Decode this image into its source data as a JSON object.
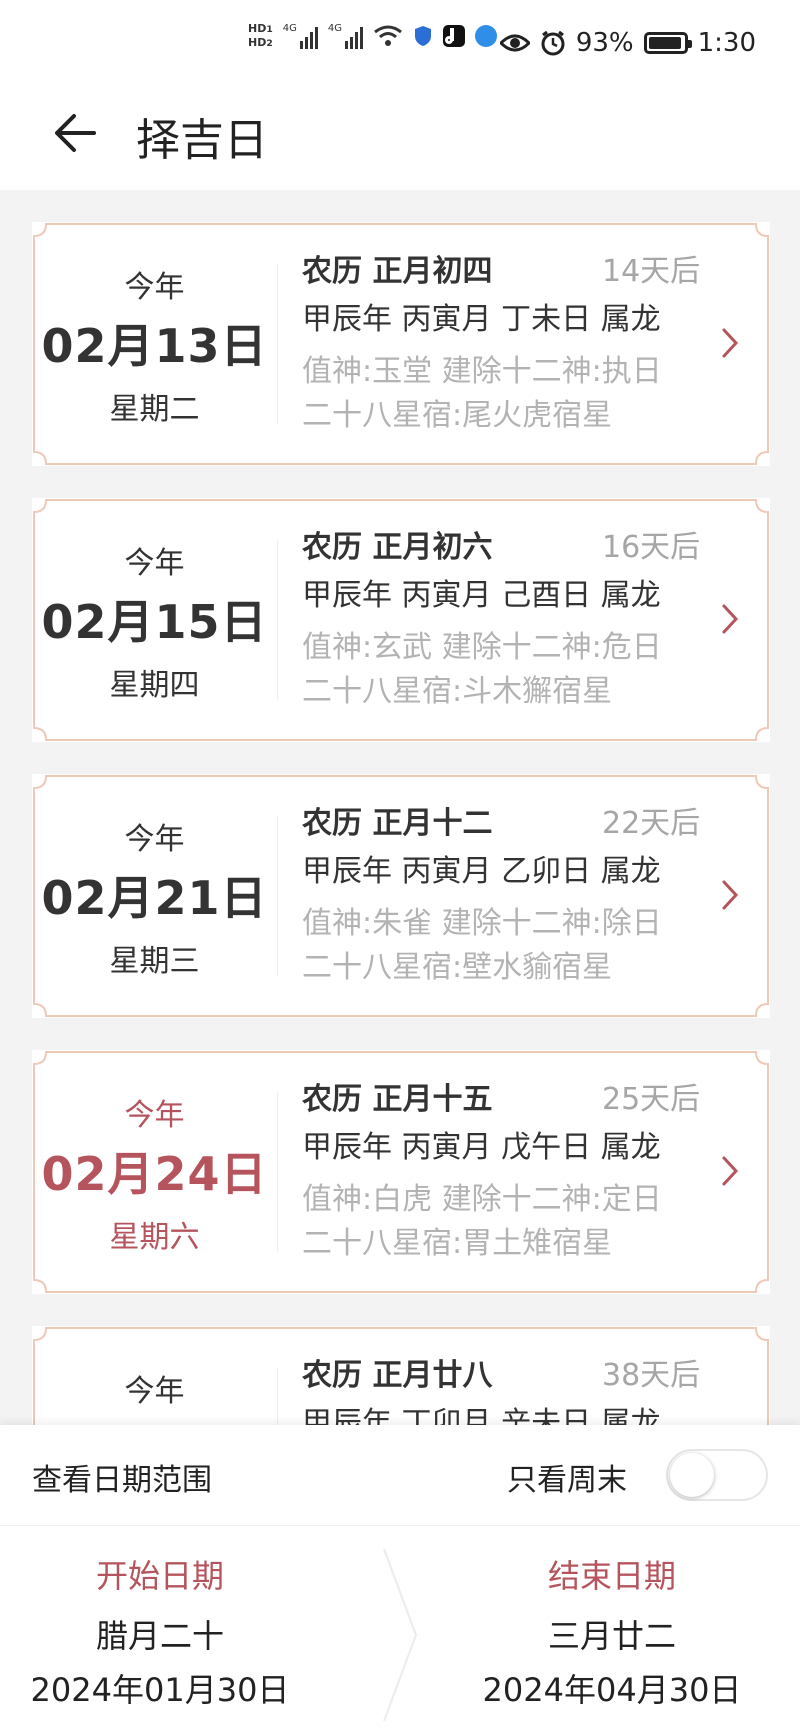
{
  "status_bar": {
    "hd1": "HD",
    "hd1_sub": "1",
    "hd2": "HD",
    "hd2_sub": "2",
    "sig1": "4G",
    "sig2": "4G",
    "battery": "93%",
    "time": "1:30",
    "icons": [
      "signal-icon",
      "wifi-icon",
      "shield-icon",
      "tiktok-icon",
      "browser-icon",
      "eye-icon",
      "alarm-icon",
      "battery-icon"
    ]
  },
  "header": {
    "title": "择吉日"
  },
  "days": [
    {
      "year": "今年",
      "date": "02月13日",
      "weekday": "星期二",
      "lunar": "农历 正月初四",
      "days_after": "14天后",
      "ganzhi": "甲辰年 丙寅月 丁未日 属龙",
      "deity": "值神:玉堂 建除十二神:执日",
      "mansion": "二十八星宿:尾火虎宿星",
      "highlight": false
    },
    {
      "year": "今年",
      "date": "02月15日",
      "weekday": "星期四",
      "lunar": "农历 正月初六",
      "days_after": "16天后",
      "ganzhi": "甲辰年 丙寅月 己酉日 属龙",
      "deity": "值神:玄武 建除十二神:危日",
      "mansion": "二十八星宿:斗木獬宿星",
      "highlight": false
    },
    {
      "year": "今年",
      "date": "02月21日",
      "weekday": "星期三",
      "lunar": "农历 正月十二",
      "days_after": "22天后",
      "ganzhi": "甲辰年 丙寅月 乙卯日 属龙",
      "deity": "值神:朱雀 建除十二神:除日",
      "mansion": "二十八星宿:壁水貐宿星",
      "highlight": false
    },
    {
      "year": "今年",
      "date": "02月24日",
      "weekday": "星期六",
      "lunar": "农历 正月十五",
      "days_after": "25天后",
      "ganzhi": "甲辰年 丙寅月 戊午日 属龙",
      "deity": "值神:白虎 建除十二神:定日",
      "mansion": "二十八星宿:胃土雉宿星",
      "highlight": true
    },
    {
      "year": "今年",
      "date": "",
      "weekday": "",
      "lunar": "农历 正月廿八",
      "days_after": "38天后",
      "ganzhi": "甲辰年 丁卯月 辛未日 属龙",
      "deity": "",
      "mansion": "",
      "highlight": false
    }
  ],
  "filter": {
    "range_label": "查看日期范围",
    "weekend_label": "只看周末",
    "weekend_only": false
  },
  "range": {
    "start": {
      "label": "开始日期",
      "lunar": "腊月二十",
      "date": "2024年01月30日"
    },
    "end": {
      "label": "结束日期",
      "lunar": "三月廿二",
      "date": "2024年04月30日"
    }
  },
  "colors": {
    "accent": "#b5545c",
    "card_border": "#f0c8b8"
  }
}
